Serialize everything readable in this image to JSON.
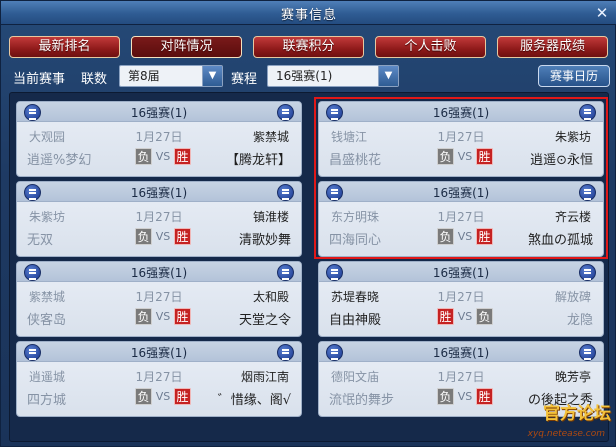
{
  "window": {
    "title": "赛事信息",
    "close_glyph": "✕"
  },
  "tabs": [
    {
      "label": "最新排名",
      "active": false
    },
    {
      "label": "对阵情况",
      "active": true
    },
    {
      "label": "联赛积分",
      "active": false
    },
    {
      "label": "个人击败",
      "active": false
    },
    {
      "label": "服务器成绩",
      "active": false
    }
  ],
  "toolbar": {
    "current_label": "当前赛事",
    "league_label": "联数",
    "league_value": "第8届",
    "schedule_label": "赛程",
    "schedule_value": "16强赛(1)",
    "calendar_label": "赛事日历"
  },
  "result_text": {
    "win": "胜",
    "lose": "负",
    "vs": "VS"
  },
  "matches": [
    {
      "round": "16强赛(1)",
      "date": "1月27日",
      "left_server": "大观园",
      "right_server": "紫禁城",
      "left_team": "逍遥%梦幻",
      "right_team": "【腾龙轩】",
      "left_result": "负",
      "right_result": "胜"
    },
    {
      "round": "16强赛(1)",
      "date": "1月27日",
      "left_server": "钱塘江",
      "right_server": "朱紫坊",
      "left_team": "昌盛桃花",
      "right_team": "逍遥⊙永恒",
      "left_result": "负",
      "right_result": "胜"
    },
    {
      "round": "16强赛(1)",
      "date": "1月27日",
      "left_server": "朱紫坊",
      "right_server": "镇淮楼",
      "left_team": "无双",
      "right_team": "清歌妙舞",
      "left_result": "负",
      "right_result": "胜"
    },
    {
      "round": "16强赛(1)",
      "date": "1月27日",
      "left_server": "东方明珠",
      "right_server": "齐云楼",
      "left_team": "四海同心",
      "right_team": "煞血の孤城",
      "left_result": "负",
      "right_result": "胜"
    },
    {
      "round": "16强赛(1)",
      "date": "1月27日",
      "left_server": "紫禁城",
      "right_server": "太和殿",
      "left_team": "侠客岛",
      "right_team": "天堂之令",
      "left_result": "负",
      "right_result": "胜"
    },
    {
      "round": "16强赛(1)",
      "date": "1月27日",
      "left_server": "苏堤春晓",
      "right_server": "解放碑",
      "left_team": "自由神殿",
      "right_team": "龙隐",
      "left_result": "胜",
      "right_result": "负"
    },
    {
      "round": "16强赛(1)",
      "date": "1月27日",
      "left_server": "逍遥城",
      "right_server": "烟雨江南",
      "left_team": "四方城",
      "right_team": "゛惜缘、阁√",
      "left_result": "负",
      "right_result": "胜"
    },
    {
      "round": "16强赛(1)",
      "date": "1月27日",
      "left_server": "德阳文庙",
      "right_server": "晚芳亭",
      "left_team": "流氓的舞步",
      "right_team": "の後起之秀",
      "left_result": "负",
      "right_result": "胜"
    }
  ],
  "watermark": {
    "line1": "官方论坛",
    "line2": "xyq.netease.com"
  },
  "colors": {
    "tab_red": "#8f1a1a",
    "win_red": "#c52222",
    "lose_gray": "#7a7a7a",
    "highlight": "#e01818"
  }
}
